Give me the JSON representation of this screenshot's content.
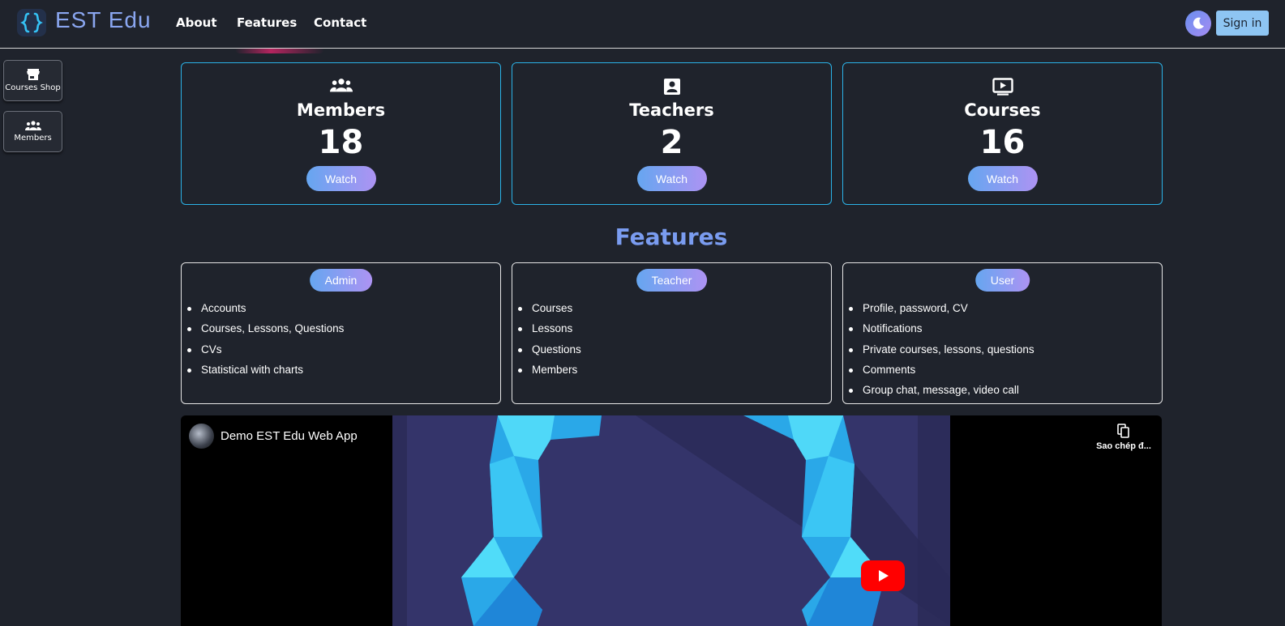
{
  "header": {
    "brand": "EST Edu",
    "nav": [
      "About",
      "Features",
      "Contact"
    ],
    "signin_label": "Sign in"
  },
  "sidebar": {
    "items": [
      {
        "label": "Courses Shop",
        "icon": "store-icon"
      },
      {
        "label": "Members",
        "icon": "people-icon"
      }
    ]
  },
  "stats": [
    {
      "title": "Members",
      "value": "18",
      "button": "Watch",
      "icon": "people-icon"
    },
    {
      "title": "Teachers",
      "value": "2",
      "button": "Watch",
      "icon": "teacher-badge-icon"
    },
    {
      "title": "Courses",
      "value": "16",
      "button": "Watch",
      "icon": "video-play-icon"
    }
  ],
  "features": {
    "title": "Features",
    "roles": [
      {
        "role": "Admin",
        "items": [
          "Accounts",
          "Courses, Lessons, Questions",
          "CVs",
          "Statistical with charts"
        ]
      },
      {
        "role": "Teacher",
        "items": [
          "Courses",
          "Lessons",
          "Questions",
          "Members"
        ]
      },
      {
        "role": "User",
        "items": [
          "Profile, password, CV",
          "Notifications",
          "Private courses, lessons, questions",
          "Comments",
          "Group chat, message, video call"
        ]
      }
    ]
  },
  "video": {
    "title": "Demo EST Edu Web App",
    "copy_label": "Sao chép đ..."
  },
  "colors": {
    "background": "#1f232c",
    "card_border": "#2bb3e8",
    "accent_start": "#66a6f0",
    "accent_end": "#ad93f3",
    "features_title": "#7a9cf0",
    "play_button": "#ff0000"
  }
}
